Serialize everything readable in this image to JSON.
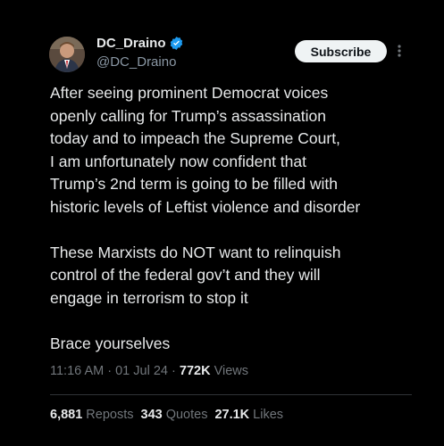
{
  "author": {
    "display_name": "DC_Draino",
    "handle": "@DC_Draino",
    "verified": true
  },
  "header": {
    "subscribe_label": "Subscribe",
    "more_icon": "more-vertical-icon"
  },
  "tweet": {
    "paragraphs": [
      [
        "After seeing prominent Democrat voices",
        "openly calling for Trump’s assassination",
        "today and to impeach the Supreme Court,",
        "I am unfortunately now confident that",
        "Trump’s 2nd term is going to be filled with",
        "historic levels of Leftist violence and disorder"
      ],
      [
        "These Marxists do NOT want to relinquish",
        "control of the federal gov’t and they will",
        "engage in terrorism to stop it"
      ],
      [
        "Brace yourselves"
      ]
    ]
  },
  "meta": {
    "time": "11:16 AM",
    "date": "01 Jul 24",
    "separator": "·",
    "views_count": "772K",
    "views_label": "Views"
  },
  "stats": {
    "reposts_count": "6,881",
    "reposts_label": "Reposts",
    "quotes_count": "343",
    "quotes_label": "Quotes",
    "likes_count": "27.1K",
    "likes_label": "Likes"
  },
  "colors": {
    "background": "#000000",
    "text": "#e7e9ea",
    "secondary": "#71767b",
    "verified_blue": "#1d9bf0"
  }
}
